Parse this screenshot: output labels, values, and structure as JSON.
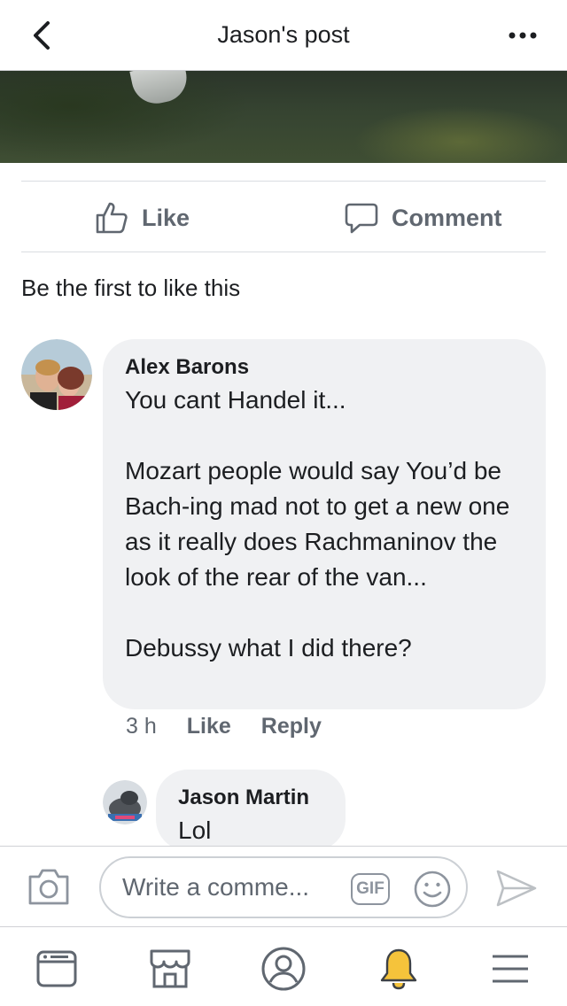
{
  "header": {
    "title": "Jason's post",
    "back_icon": "chevron-left-icon",
    "more_icon": "more-dots-icon"
  },
  "actions": {
    "like_label": "Like",
    "comment_label": "Comment"
  },
  "reactions": {
    "summary": "Be the first to like this"
  },
  "comments": [
    {
      "author": "Alex Barons",
      "text": "You cant Handel it...\n\nMozart people would say You’d be Bach-ing mad not to get a new one as it really does Rachmaninov the look of the rear of the van...\n\nDebussy what I did there?",
      "time": "3 h",
      "like_label": "Like",
      "reply_label": "Reply"
    },
    {
      "author": "Jason Martin",
      "text": "Lol"
    }
  ],
  "composer": {
    "placeholder": "Write a comme...",
    "gif_label": "GIF"
  },
  "nav": [
    "news-feed-icon",
    "marketplace-icon",
    "profile-icon",
    "notifications-bell-icon",
    "menu-icon"
  ],
  "colors": {
    "text": "#1c1e21",
    "secondary": "#606770",
    "bubble": "#f0f1f3",
    "bell": "#f5c33b"
  }
}
